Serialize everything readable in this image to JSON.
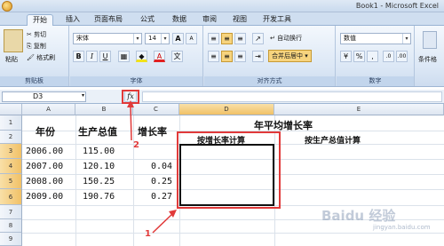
{
  "window": {
    "title": "Book1 - Microsoft Excel"
  },
  "tabs": [
    "开始",
    "插入",
    "页面布局",
    "公式",
    "数据",
    "审阅",
    "视图",
    "开发工具"
  ],
  "ribbon": {
    "clipboard": {
      "paste": "粘贴",
      "cut": "剪切",
      "copy": "复制",
      "format_painter": "格式刷",
      "label": "剪贴板"
    },
    "font": {
      "name": "宋体",
      "size": "14",
      "grow": "A",
      "shrink": "A",
      "bold": "B",
      "italic": "I",
      "underline": "U",
      "label": "字体"
    },
    "alignment": {
      "wrap": "自动换行",
      "merge": "合并后居中",
      "label": "对齐方式"
    },
    "number": {
      "format": "数值",
      "label": "数字"
    },
    "styles": {
      "conditional": "条件格"
    }
  },
  "formula_bar": {
    "name_box": "D3",
    "fx": "fx",
    "content": ""
  },
  "columns": [
    "A",
    "B",
    "C",
    "D",
    "E"
  ],
  "rows": [
    "1",
    "2",
    "3",
    "4",
    "5",
    "6",
    "7",
    "8",
    "9"
  ],
  "sheet": {
    "header_year": "年份",
    "header_value": "生产总值",
    "header_rate": "增长率",
    "title": "年平均增长率",
    "sub_rate": "按增长率计算",
    "sub_value": "按生产总值计算",
    "years": [
      "2006.00",
      "2007.00",
      "2008.00",
      "2009.00"
    ],
    "values": [
      "115.00",
      "120.10",
      "150.25",
      "190.76"
    ],
    "rates": [
      "",
      "0.04",
      "0.25",
      "0.27"
    ]
  },
  "annotations": {
    "one": "1",
    "two": "2"
  },
  "watermark": {
    "main": "Baidu 经验",
    "sub": "jingyan.baidu.com"
  }
}
